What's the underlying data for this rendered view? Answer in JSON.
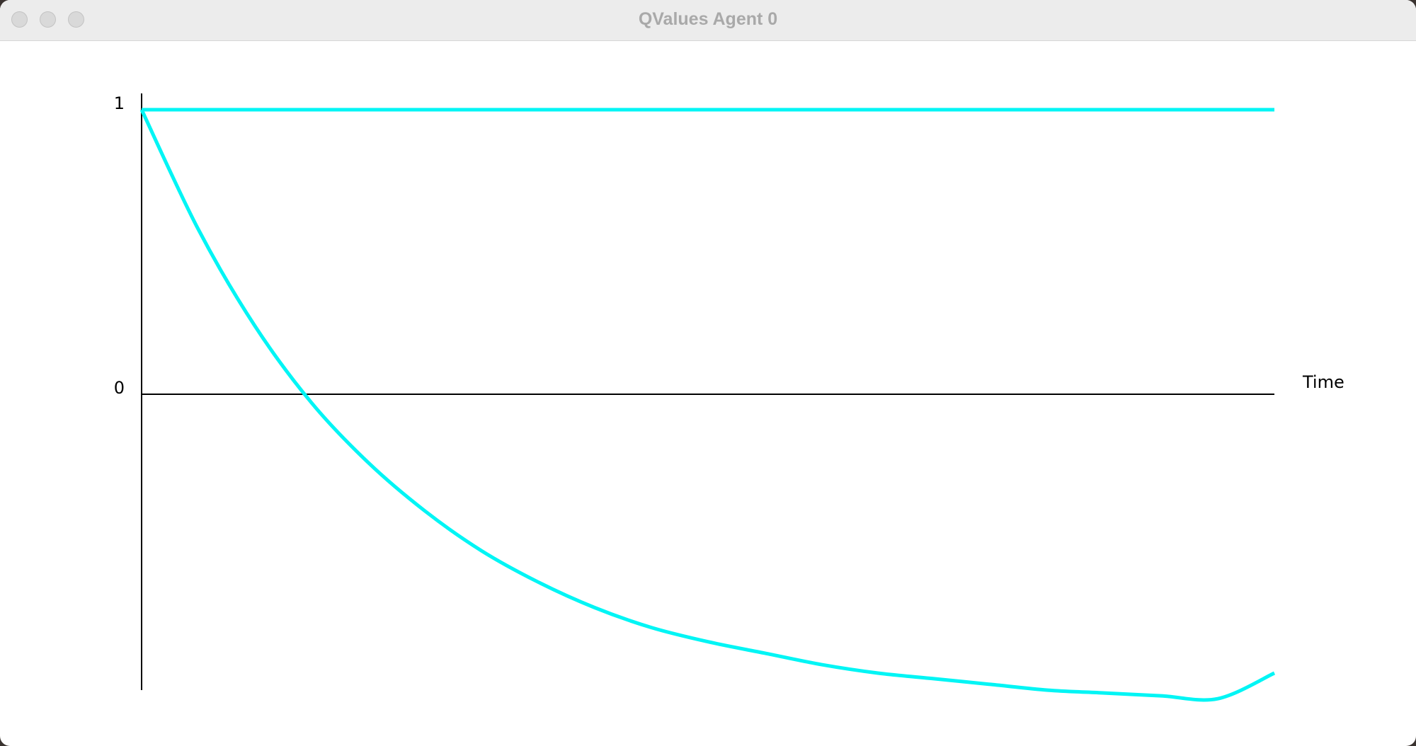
{
  "window": {
    "title": "QValues Agent 0"
  },
  "colors": {
    "series": "#00f5f5",
    "axis": "#000000",
    "background": "#ffffff",
    "titlebar": "#ececec",
    "title_text": "#a9a9a9"
  },
  "chart_data": {
    "type": "line",
    "title": "",
    "xlabel": "Time",
    "ylabel": "",
    "yticks": [
      "1",
      "0"
    ],
    "ylim": [
      -1,
      1
    ],
    "xlim": [
      0,
      100
    ],
    "grid": false,
    "legend": "none",
    "series": [
      {
        "x": [
          0,
          100
        ],
        "y": [
          1,
          1
        ]
      },
      {
        "x": [
          0,
          5,
          10,
          15,
          20,
          25,
          30,
          35,
          40,
          45,
          50,
          55,
          60,
          65,
          70,
          75,
          80,
          85,
          90,
          95,
          100
        ],
        "y": [
          1,
          0.58,
          0.24,
          -0.03,
          -0.24,
          -0.41,
          -0.55,
          -0.66,
          -0.75,
          -0.82,
          -0.87,
          -0.91,
          -0.95,
          -0.98,
          -1.0,
          -1.02,
          -1.04,
          -1.05,
          -1.06,
          -1.07,
          -0.98
        ]
      }
    ]
  }
}
